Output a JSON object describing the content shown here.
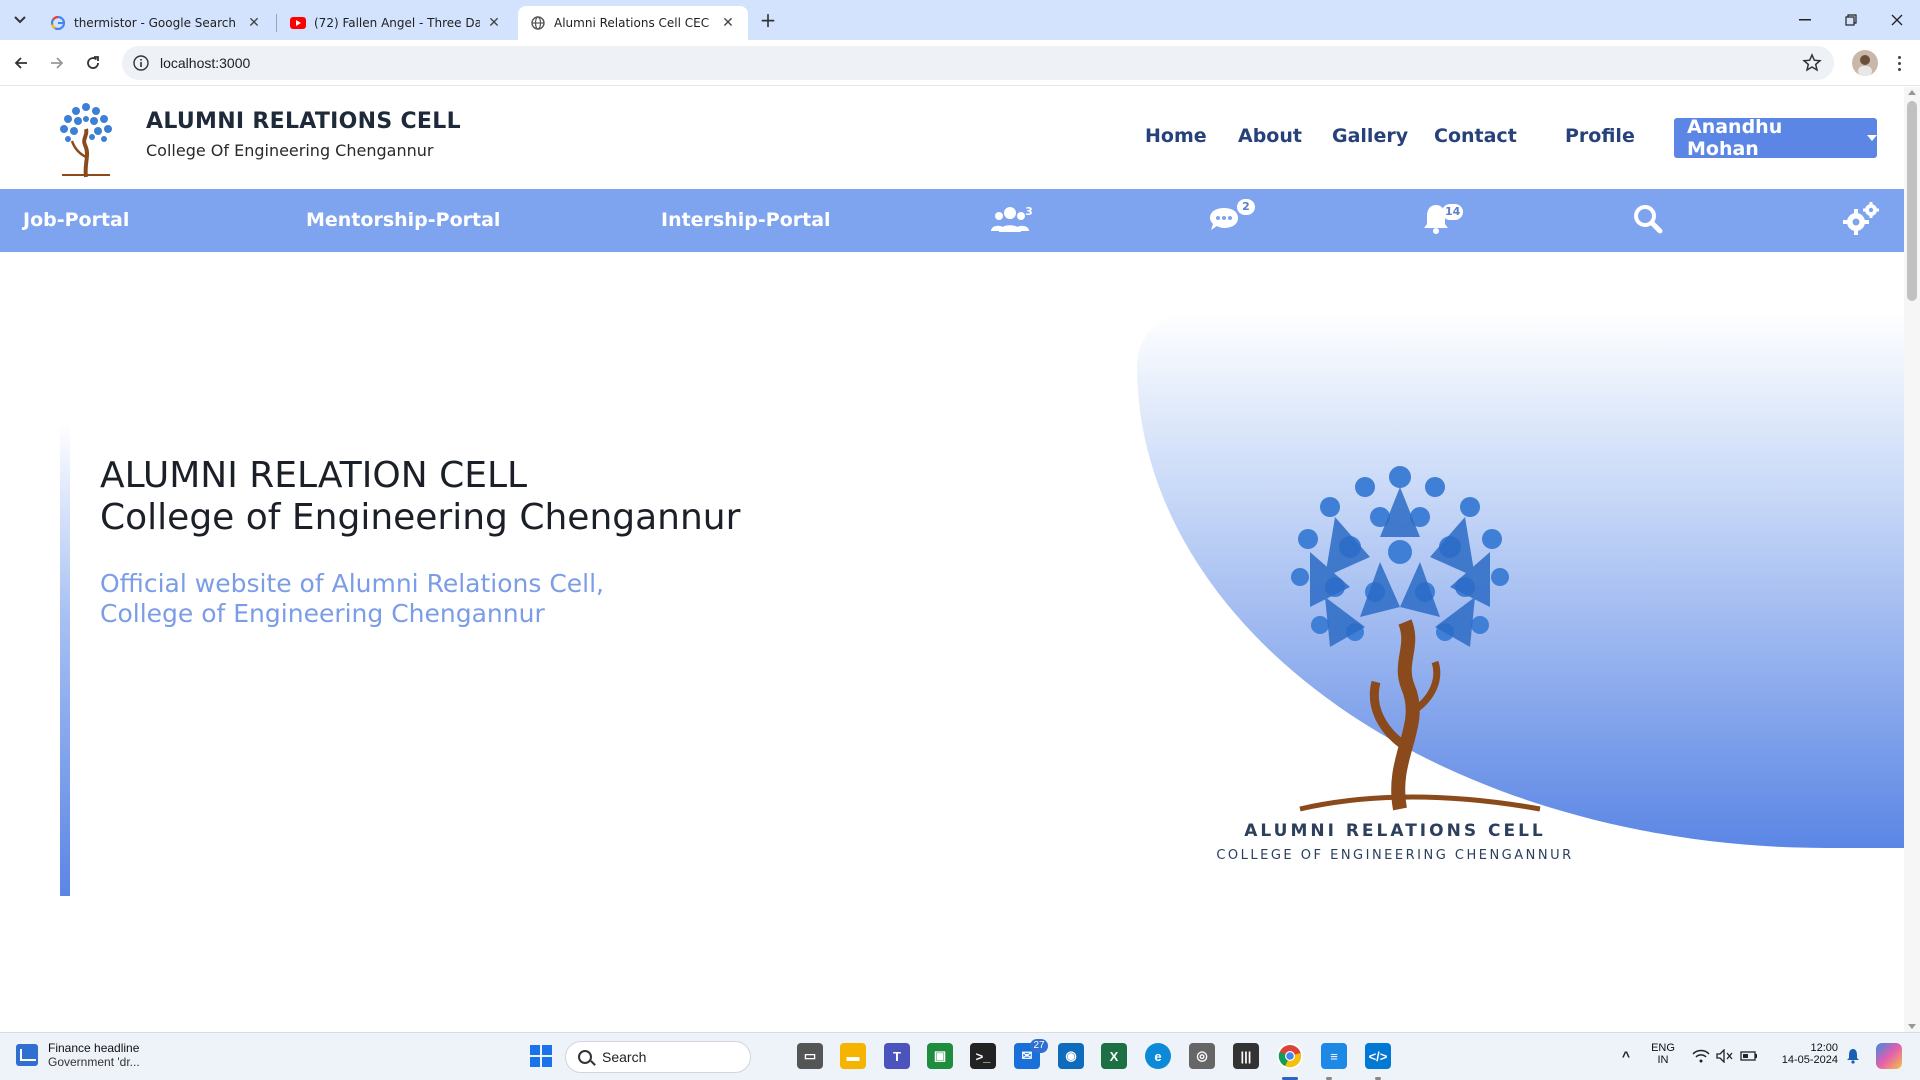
{
  "browser": {
    "tabs": [
      {
        "title": "thermistor - Google Search",
        "favicon": "google-icon",
        "active": false
      },
      {
        "title": "(72) Fallen Angel - Three Days G",
        "favicon": "youtube-icon",
        "active": false
      },
      {
        "title": "Alumni Relations Cell CEC",
        "favicon": "globe-icon",
        "active": true
      }
    ],
    "url": "localhost:3000"
  },
  "site": {
    "brand_title": "ALUMNI RELATIONS CELL",
    "brand_subtitle": "College Of Engineering Chengannur",
    "nav": [
      "Home",
      "About",
      "Gallery",
      "Contact",
      "Profile"
    ],
    "user_name": "Anandhu Mohan",
    "portals": [
      "Job-Portal",
      "Mentorship-Portal",
      "Intership-Portal"
    ],
    "badges": {
      "users": "3",
      "messages": "2",
      "notifications": "14"
    },
    "hero": {
      "title_line1": "ALUMNI RELATION CELL",
      "title_line2": "College of Engineering Chengannur",
      "sub_line1": "Official website of Alumni Relations Cell,",
      "sub_line2": "College of Engineering Chengannur",
      "logo_title": "ALUMNI RELATIONS CELL",
      "logo_subtitle": "COLLEGE OF ENGINEERING CHENGANNUR"
    },
    "colors": {
      "accent": "#5b86e5",
      "portal_bar": "#7ea3ef",
      "nav_text": "#27417a"
    }
  },
  "taskbar": {
    "widget_title": "Finance headline",
    "widget_text": "Government 'dr...",
    "search_placeholder": "Search",
    "mail_badge": "27",
    "language": "ENG",
    "region": "IN",
    "time": "12:00",
    "date": "14-05-2024"
  }
}
